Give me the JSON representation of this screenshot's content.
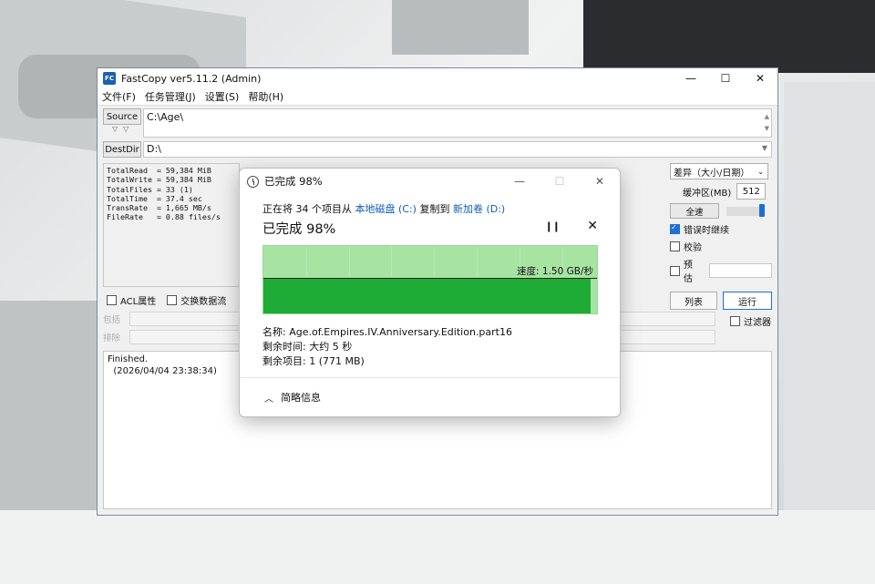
{
  "fastcopy": {
    "title": "FastCopy ver5.11.2 (Admin)",
    "app_icon_text": "FC",
    "menu": [
      "文件(F)",
      "任务管理(J)",
      "设置(S)",
      "帮助(H)"
    ],
    "source_label": "Source",
    "source_value": "C:\\Age\\",
    "destdir_label": "DestDir",
    "destdir_value": "D:\\",
    "stats": [
      "TotalRead  = 59,384 MiB",
      "TotalWrite = 59,384 MiB",
      "TotalFiles = 33 (1)",
      "TotalTime  = 37.4 sec",
      "TransRate  = 1,665 MB/s",
      "FileRate   = 0.88 files/s"
    ],
    "mode": "差异（大小/日期）",
    "buffer_label": "缓冲区(MB)",
    "buffer_value": "512",
    "speed_label": "全速",
    "checks": [
      {
        "label": "错误时继续",
        "checked": true
      },
      {
        "label": "校验",
        "checked": false
      },
      {
        "label": "预估",
        "checked": false
      }
    ],
    "list_button": "列表",
    "run_button": "运行",
    "acl_label": "ACL属性",
    "stream_label": "交换数据流",
    "include_label": "包括",
    "exclude_label": "排除",
    "filter_label": "过滤器",
    "log": [
      "Finished.",
      "  (2026/04/04 23:38:34)"
    ]
  },
  "dialog": {
    "title": "已完成 98%",
    "info_prefix": "正在将 34 个项目从 ",
    "info_src": "本地磁盘 (C:)",
    "info_mid": " 复制到 ",
    "info_dst": "新加卷 (D:)",
    "progress_heading": "已完成 98%",
    "progress_fraction": 0.98,
    "speed": "速度: 1.50 GB/秒",
    "name_line": "名称:  Age.of.Empires.IV.Anniversary.Edition.part16",
    "time_line": "剩余时间:  大约 5 秒",
    "items_line": "剩余项目:  1 (771 MB)",
    "footer": "简略信息"
  }
}
